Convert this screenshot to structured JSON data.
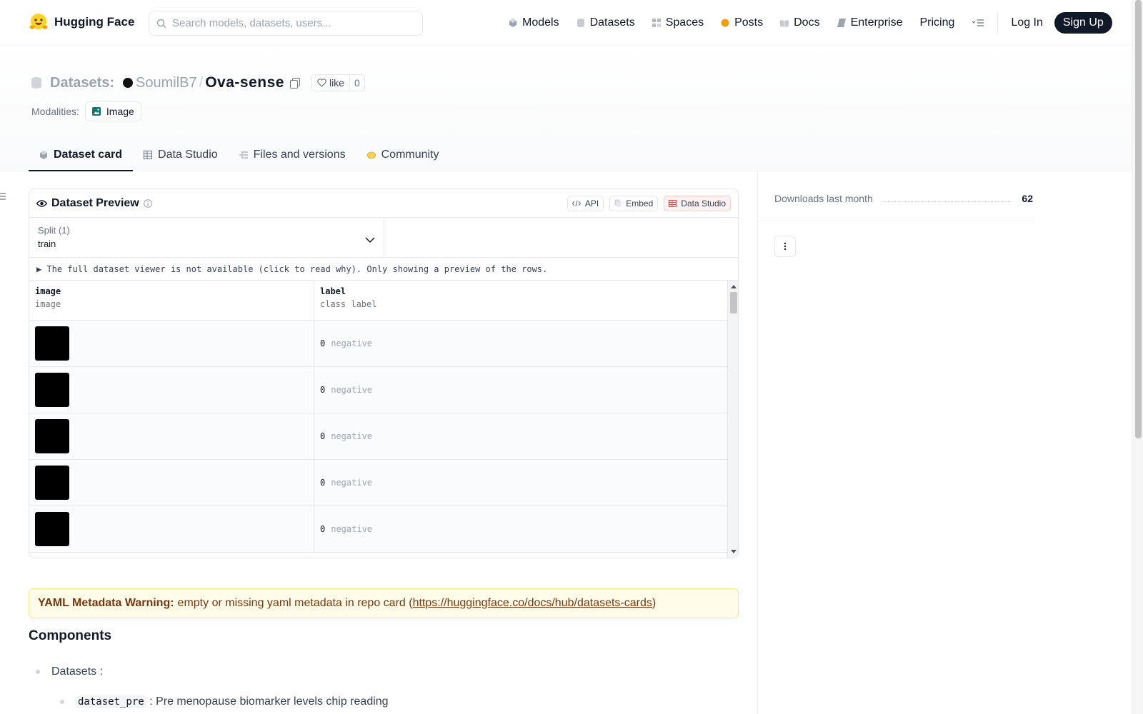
{
  "brand": {
    "name": "Hugging Face"
  },
  "search": {
    "placeholder": "Search models, datasets, users..."
  },
  "nav": {
    "items": [
      {
        "label": "Models",
        "icon": "cube-icon"
      },
      {
        "label": "Datasets",
        "icon": "database-icon"
      },
      {
        "label": "Spaces",
        "icon": "grid-icon"
      },
      {
        "label": "Posts",
        "icon": "posts-icon"
      },
      {
        "label": "Docs",
        "icon": "book-icon"
      },
      {
        "label": "Enterprise",
        "icon": "enterprise-icon"
      },
      {
        "label": "Pricing"
      }
    ],
    "login": "Log In",
    "signup": "Sign Up"
  },
  "repo": {
    "type_label": "Datasets:",
    "owner": "SoumilB7",
    "name": "Ova-sense",
    "like_label": "like",
    "like_count": "0",
    "modalities_label": "Modalities:",
    "modality": "Image"
  },
  "tabs": [
    {
      "label": "Dataset card",
      "active": true
    },
    {
      "label": "Data Studio"
    },
    {
      "label": "Files and versions"
    },
    {
      "label": "Community"
    }
  ],
  "preview": {
    "title": "Dataset Preview",
    "api_label": "API",
    "embed_label": "Embed",
    "studio_label": "Data Studio",
    "split_label": "Split (1)",
    "split_value": "train",
    "notice": "▶ The full dataset viewer is not available (click to read why). Only showing a preview of the rows.",
    "columns": [
      {
        "name": "image",
        "type": "image"
      },
      {
        "name": "label",
        "type": "class label"
      }
    ],
    "rows": [
      {
        "label_id": "0",
        "label_name": "negative"
      },
      {
        "label_id": "0",
        "label_name": "negative"
      },
      {
        "label_id": "0",
        "label_name": "negative"
      },
      {
        "label_id": "0",
        "label_name": "negative"
      },
      {
        "label_id": "0",
        "label_name": "negative"
      }
    ]
  },
  "warning": {
    "bold": "YAML Metadata Warning:",
    "text_before": "empty or missing yaml metadata in repo card (",
    "link": "https://huggingface.co/docs/hub/datasets-cards",
    "text_after": ")"
  },
  "card": {
    "heading": "Components",
    "item1": "Datasets :",
    "item2_code": "dataset_pre",
    "item2_text": ": Pre menopause biomarker levels chip reading"
  },
  "sidebar": {
    "downloads_label": "Downloads last month",
    "downloads_value": "62"
  },
  "colors": {
    "accent_dark": "#111827",
    "warning_bg": "#fefce8",
    "warning_text": "#78350f"
  }
}
